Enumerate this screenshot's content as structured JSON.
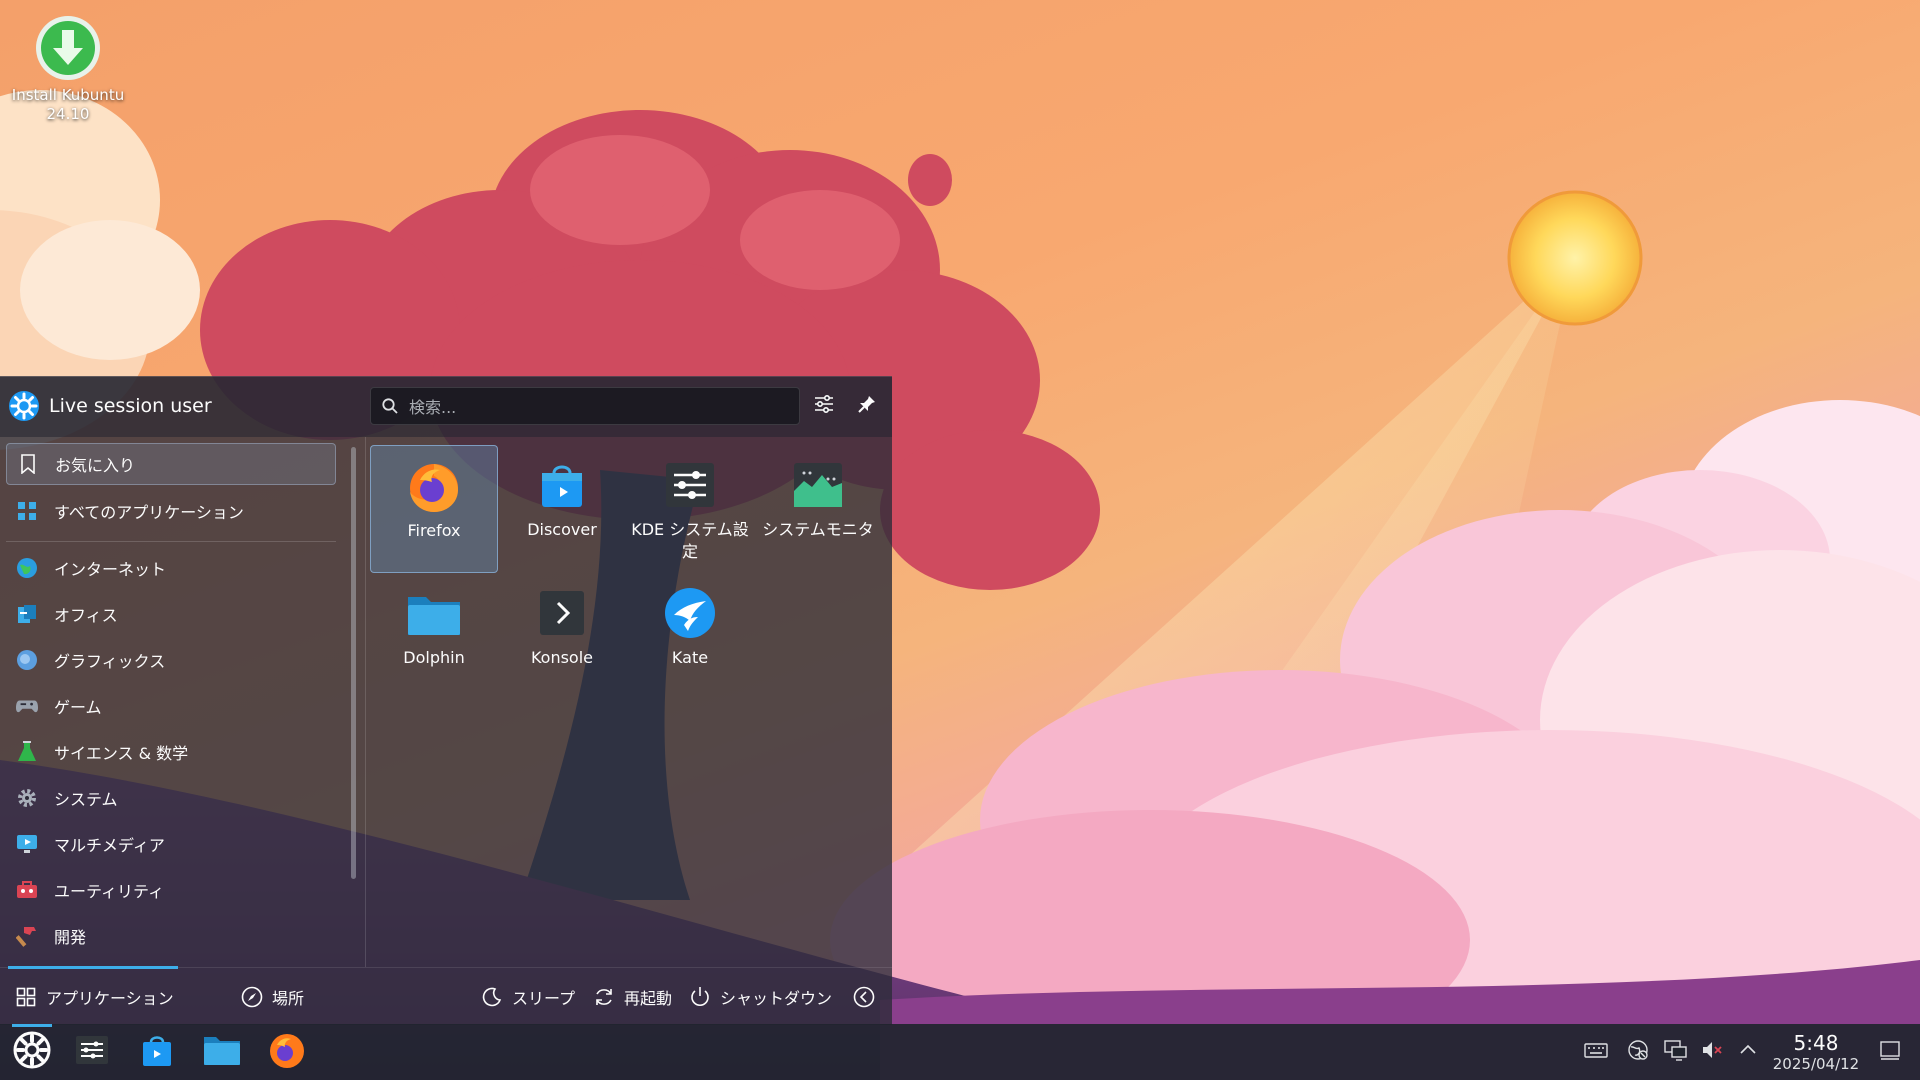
{
  "desktop": {
    "install_icon": {
      "label": "Install Kubuntu 24.10",
      "icon": "download-icon"
    }
  },
  "launcher": {
    "user_name": "Live session user",
    "search": {
      "placeholder": "検索...",
      "value": ""
    },
    "header_buttons": {
      "configure": "configure-icon",
      "pin": "pin-icon"
    },
    "categories": [
      {
        "label": "お気に入り",
        "icon": "bookmark-icon",
        "selected": true
      },
      {
        "label": "すべてのアプリケーション",
        "icon": "grid-icon"
      },
      {
        "label": "インターネット",
        "icon": "globe-icon"
      },
      {
        "label": "オフィス",
        "icon": "office-icon"
      },
      {
        "label": "グラフィックス",
        "icon": "graphics-icon"
      },
      {
        "label": "ゲーム",
        "icon": "gamepad-icon"
      },
      {
        "label": "サイエンス & 数学",
        "icon": "flask-icon"
      },
      {
        "label": "システム",
        "icon": "gear-icon"
      },
      {
        "label": "マルチメディア",
        "icon": "multimedia-icon"
      },
      {
        "label": "ユーティリティ",
        "icon": "utility-icon"
      },
      {
        "label": "開発",
        "icon": "hammer-icon"
      }
    ],
    "favorites": [
      {
        "label": "Firefox",
        "icon": "firefox-icon",
        "selected": true
      },
      {
        "label": "Discover",
        "icon": "discover-icon"
      },
      {
        "label": "KDE システム設定",
        "icon": "system-settings-icon"
      },
      {
        "label": "システムモニタ",
        "icon": "system-monitor-icon"
      },
      {
        "label": "Dolphin",
        "icon": "folder-icon"
      },
      {
        "label": "Konsole",
        "icon": "terminal-icon"
      },
      {
        "label": "Kate",
        "icon": "kate-icon"
      }
    ],
    "footer": {
      "tab_applications": "アプリケーション",
      "tab_places": "場所",
      "sleep": "スリープ",
      "restart": "再起動",
      "shutdown": "シャットダウン"
    }
  },
  "taskbar": {
    "launcher_icon": "kde-menu-icon",
    "pinned": [
      "system-settings-icon",
      "discover-icon",
      "folder-icon",
      "firefox-icon"
    ],
    "tray": [
      "keyboard-icon",
      "network-icon",
      "display-icon",
      "volume-muted-icon",
      "expand-arrow-icon"
    ],
    "clock": {
      "time": "5:48",
      "date": "2025/04/12"
    }
  },
  "colors": {
    "accent": "#3daee9",
    "panel_bg": "#20242e",
    "menu_bg": "#2c2c38"
  }
}
